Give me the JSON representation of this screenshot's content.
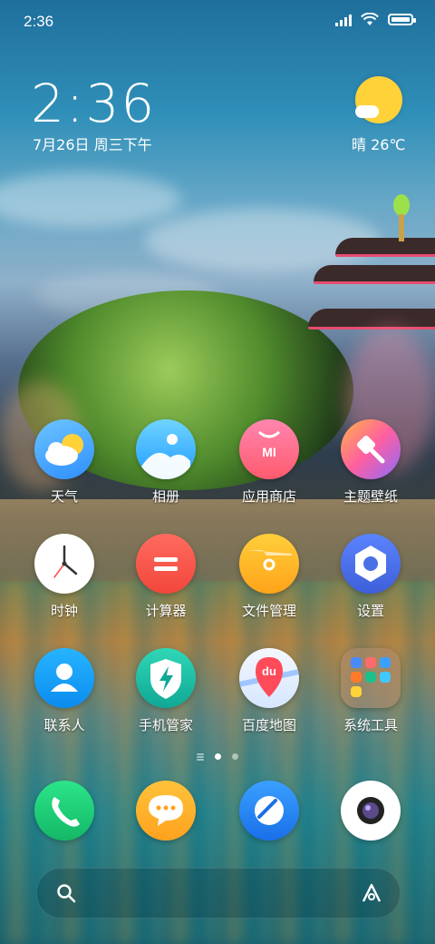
{
  "status_bar": {
    "time": "2:36",
    "icons": [
      "signal-icon",
      "wifi-icon",
      "battery-icon"
    ]
  },
  "clock_widget": {
    "time": "2:36",
    "date": "7月26日 周三下午"
  },
  "weather_widget": {
    "icon": "partly-sunny-icon",
    "text": "晴 26℃"
  },
  "apps": [
    {
      "label": "天气",
      "icon": "weather-app-icon",
      "color": "#4aa8ff"
    },
    {
      "label": "相册",
      "icon": "gallery-app-icon",
      "color": "#2bb6ff"
    },
    {
      "label": "应用商店",
      "icon": "app-store-icon",
      "color": "#ff6a8a"
    },
    {
      "label": "主题壁纸",
      "icon": "themes-icon",
      "color": "#ff5fa0"
    },
    {
      "label": "时钟",
      "icon": "clock-app-icon",
      "color": "#ffffff"
    },
    {
      "label": "计算器",
      "icon": "calculator-icon",
      "color": "#ff5a4f"
    },
    {
      "label": "文件管理",
      "icon": "file-manager-icon",
      "color": "#ffb020"
    },
    {
      "label": "设置",
      "icon": "settings-icon",
      "color": "#4a70e6"
    },
    {
      "label": "联系人",
      "icon": "contacts-icon",
      "color": "#1a9dff"
    },
    {
      "label": "手机管家",
      "icon": "security-icon",
      "color": "#1ec0a8"
    },
    {
      "label": "百度地图",
      "icon": "baidu-maps-icon",
      "color": "#eaf2ff"
    },
    {
      "label": "系统工具",
      "icon": "system-tools-folder-icon",
      "color": "#7a6a60"
    }
  ],
  "dock": [
    {
      "icon": "phone-icon",
      "color": "#1fd07a"
    },
    {
      "icon": "messages-icon",
      "color": "#ffb92e"
    },
    {
      "icon": "browser-icon",
      "color": "#2b8cff"
    },
    {
      "icon": "camera-icon",
      "color": "#ffffff"
    }
  ],
  "page_indicator": {
    "pages": 2,
    "active": 1
  },
  "search_bar": {
    "left_icon": "search-icon",
    "right_icon": "assistant-icon"
  }
}
